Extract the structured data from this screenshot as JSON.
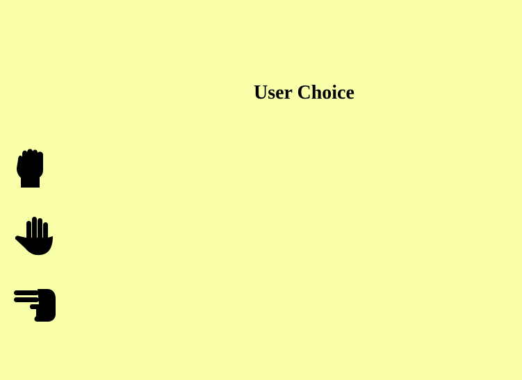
{
  "header": {
    "title": "User Choice"
  },
  "choices": [
    {
      "id": "rock",
      "icon": "hand-rock-icon"
    },
    {
      "id": "paper",
      "icon": "hand-paper-icon"
    },
    {
      "id": "scissors",
      "icon": "hand-scissors-icon"
    }
  ],
  "colors": {
    "background": "#f9ffa8",
    "icon": "#000000",
    "text": "#000000"
  }
}
